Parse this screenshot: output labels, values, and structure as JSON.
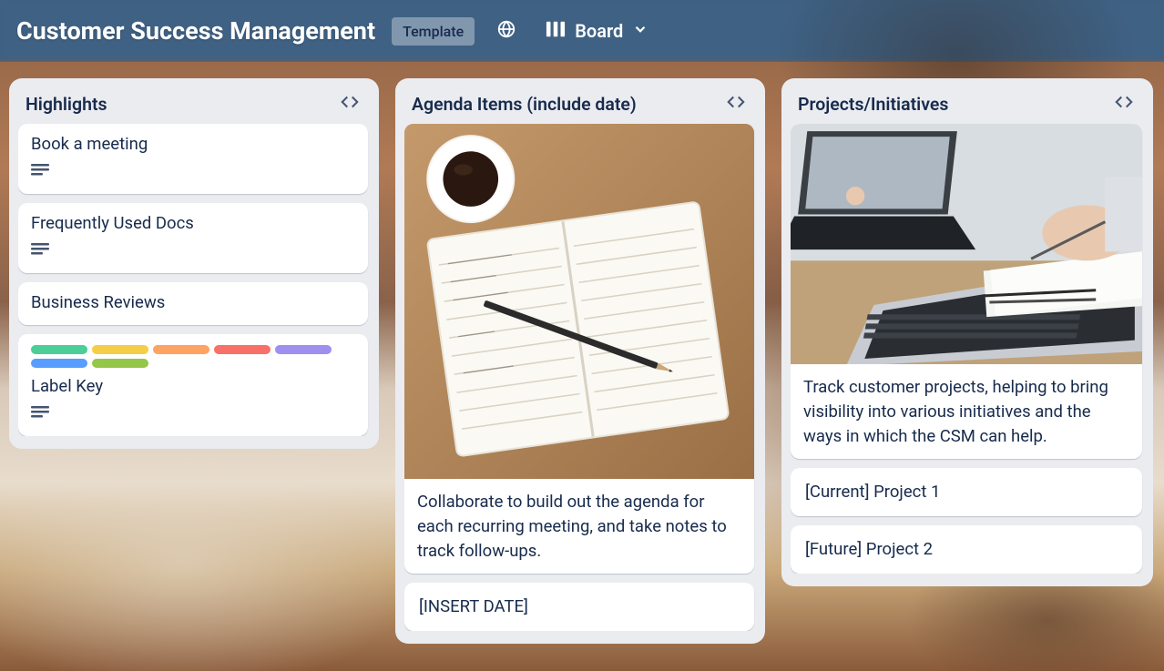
{
  "header": {
    "title": "Customer Success Management",
    "template_label": "Template",
    "view_label": "Board",
    "icons": {
      "visibility": "globe-icon",
      "view_mode": "board-layout-icon",
      "chevron": "chevron-down-icon"
    }
  },
  "lists": [
    {
      "title": "Highlights",
      "cards": [
        {
          "title": "Book a meeting",
          "has_description": true
        },
        {
          "title": "Frequently Used Docs",
          "has_description": true
        },
        {
          "title": "Business Reviews"
        },
        {
          "title": "Label Key",
          "has_description": true,
          "labels": [
            {
              "color": "#4bce97",
              "width": 62
            },
            {
              "color": "#f5cd47",
              "width": 62
            },
            {
              "color": "#fea362",
              "width": 62
            },
            {
              "color": "#f87168",
              "width": 62
            },
            {
              "color": "#9f8fef",
              "width": 62
            },
            {
              "color": "#579dff",
              "width": 62
            },
            {
              "color": "#94c748",
              "width": 62
            }
          ]
        }
      ]
    },
    {
      "title": "Agenda Items (include date)",
      "cards": [
        {
          "cover": "notebook",
          "description": "Collaborate to build out the agenda for each recurring meeting, and take notes to track follow-ups."
        },
        {
          "title": "[INSERT DATE]"
        }
      ]
    },
    {
      "title": "Projects/Initiatives",
      "cards": [
        {
          "cover": "laptops",
          "description": "Track customer projects, helping to bring visibility into various initiatives and the ways in which the CSM can help."
        },
        {
          "title": "[Current] Project 1"
        },
        {
          "title": "[Future] Project 2"
        }
      ]
    }
  ]
}
